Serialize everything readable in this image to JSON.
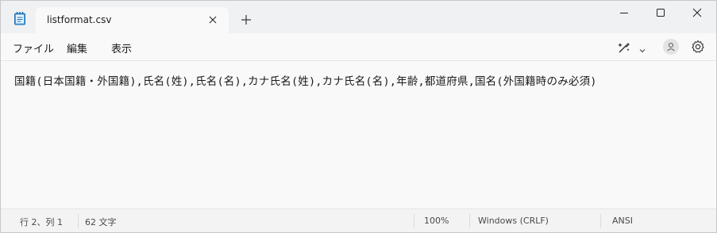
{
  "tab": {
    "title": "listformat.csv"
  },
  "menu": {
    "file": "ファイル",
    "edit": "編集",
    "view": "表示"
  },
  "editor": {
    "lines": [
      "国籍(日本国籍・外国籍),氏名(姓),氏名(名),カナ氏名(姓),カナ氏名(名),年齢,都道府県,国名(外国籍時のみ必須)"
    ]
  },
  "status": {
    "position": "行 2、列 1",
    "char_count": "62 文字",
    "zoom": "100%",
    "line_ending": "Windows (CRLF)",
    "encoding": "ANSI"
  },
  "icons": {
    "app": "notepad-icon",
    "tab_close": "close-icon",
    "new_tab": "plus-icon",
    "minimize": "minimize-icon",
    "maximize": "maximize-icon",
    "close": "close-icon",
    "copilot": "copilot-icon",
    "account": "account-icon",
    "settings": "gear-icon"
  },
  "colors": {
    "accent": "#0f6cbd",
    "titlebar": "#f0f1f3",
    "editor_bg": "#f9f9f9"
  }
}
